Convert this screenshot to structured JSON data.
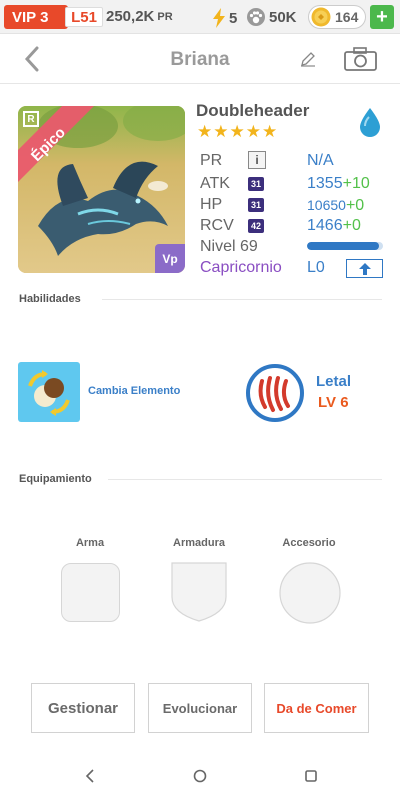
{
  "topbar": {
    "vip_label": "VIP 3",
    "level_label": "L51",
    "pr_value": "250,2K",
    "pr_unit": "PR",
    "energy_value": "5",
    "food_value": "50K",
    "coins_value": "164",
    "add_label": "+",
    "colors": {
      "vip": "#e8492a",
      "energy": "#f2b41c",
      "add": "#4cb84c"
    }
  },
  "header": {
    "title": "Briana"
  },
  "monster": {
    "rarity": "Épico",
    "rarity_tag": "R",
    "corner_badge": "Vp",
    "name": "Doubleheader",
    "stars": "★★★★★",
    "element": "water-drop-icon",
    "stats": [
      {
        "label": "PR",
        "value": "N/A",
        "bonus": ""
      },
      {
        "label": "ATK",
        "badge": "31",
        "value": "1355",
        "bonus": "+10"
      },
      {
        "label": "HP",
        "badge": "31",
        "value": "10650",
        "bonus": "+0"
      },
      {
        "label": "RCV",
        "badge": "42",
        "value": "1466",
        "bonus": "+0"
      }
    ],
    "level_label": "Nivel 69",
    "level_progress": 0.95,
    "sign_label": "Capricornio",
    "sign_level": "L0",
    "pr_info_label": "i"
  },
  "skills": {
    "section_title": "Habilidades",
    "skill1_label": "Cambia Elemento",
    "skill2_title": "Letal",
    "skill2_level": "LV 6"
  },
  "equipment": {
    "section_title": "Equipamiento",
    "slots": [
      "Arma",
      "Armadura",
      "Accesorio"
    ]
  },
  "actions": {
    "manage": "Gestionar",
    "evolve": "Evolucionar",
    "feed": "Da de Comer"
  }
}
